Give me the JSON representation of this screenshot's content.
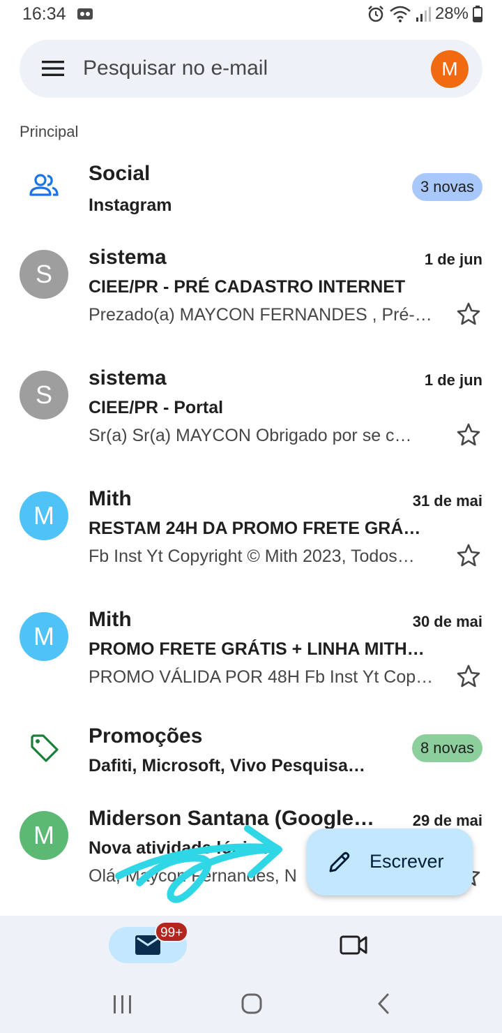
{
  "status_bar": {
    "time": "16:34",
    "battery": "28%"
  },
  "search": {
    "placeholder": "Pesquisar no e-mail",
    "avatar_letter": "M"
  },
  "section_label": "Principal",
  "categories": [
    {
      "title": "Social",
      "subtitle": "Instagram",
      "badge": "3 novas",
      "badge_color": "#a8c7fa",
      "icon": "people-icon"
    },
    {
      "title": "Promoções",
      "subtitle": "Dafiti, Microsoft, Vivo Pesquisa…",
      "badge": "8 novas",
      "badge_color": "#8ccf9d",
      "icon": "tag-icon"
    }
  ],
  "emails": [
    {
      "avatar_letter": "S",
      "avatar_color": "#9e9e9e",
      "sender": "sistema",
      "date": "1 de jun",
      "subject": "CIEE/PR - PRÉ CADASTRO INTERNET",
      "preview": "Prezado(a) MAYCON FERNANDES , Pré-…"
    },
    {
      "avatar_letter": "S",
      "avatar_color": "#9e9e9e",
      "sender": "sistema",
      "date": "1 de jun",
      "subject": "CIEE/PR - Portal",
      "preview": "Sr(a) Sr(a) MAYCON Obrigado por se c…"
    },
    {
      "avatar_letter": "M",
      "avatar_color": "#4fc3f7",
      "sender": "Mith",
      "date": "31 de mai",
      "subject": "RESTAM 24H DA PROMO FRETE GRÁ…",
      "preview": "Fb Inst Yt Copyright © Mith 2023, Todos…"
    },
    {
      "avatar_letter": "M",
      "avatar_color": "#4fc3f7",
      "sender": "Mith",
      "date": "30 de mai",
      "subject": "PROMO FRETE GRÁTIS + LINHA MITH…",
      "preview": "PROMO VÁLIDA POR 48H Fb Inst Yt Cop…"
    },
    {
      "avatar_letter": "M",
      "avatar_color": "#5bb974",
      "sender": "Miderson Santana (Google…",
      "date": "29 de mai",
      "subject": "Nova atividade lógica",
      "preview": "Olá, Maycon Fernandes, N"
    }
  ],
  "compose": {
    "label": "Escrever"
  },
  "bottom_nav": {
    "mail_badge": "99+"
  },
  "colors": {
    "accent": "#c2e7ff",
    "surface": "#eef2f8",
    "avatar_account": "#f26a0f",
    "badge_red": "#b3261e",
    "scribble": "#2fd6e6"
  }
}
